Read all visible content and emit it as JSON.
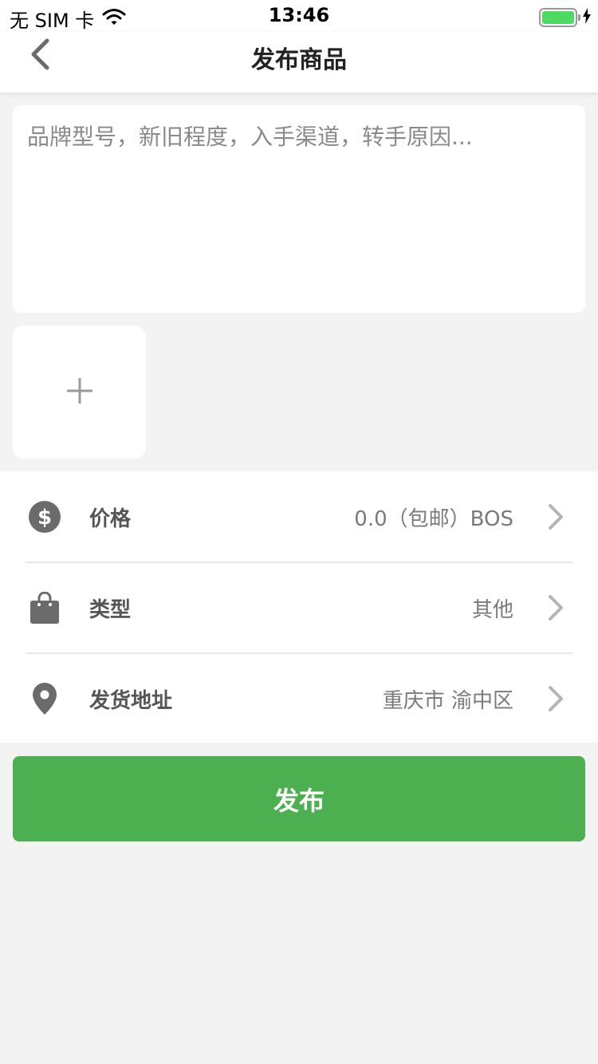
{
  "status_bar": {
    "carrier": "无 SIM 卡",
    "time": "13:46",
    "battery_icon": "battery-icon",
    "charging_icon": "bolt-icon",
    "wifi_icon": "wifi-icon"
  },
  "nav": {
    "title": "发布商品",
    "back_icon": "chevron-left-icon"
  },
  "description": {
    "placeholder": "品牌型号，新旧程度，入手渠道，转手原因...",
    "value": ""
  },
  "photo": {
    "add_icon": "plus-icon"
  },
  "settings": [
    {
      "icon": "dollar-circle-icon",
      "label": "价格",
      "value": "0.0（包邮）BOS"
    },
    {
      "icon": "shopping-bag-icon",
      "label": "类型",
      "value": "其他"
    },
    {
      "icon": "location-pin-icon",
      "label": "发货地址",
      "value": "重庆市 渝中区"
    }
  ],
  "publish_button": {
    "label": "发布"
  },
  "colors": {
    "accent": "#4caf50",
    "background": "#f3f3f3",
    "icon_gray": "#6b6b6b",
    "chevron_gray": "#b5b5b5",
    "battery_green": "#4cd964"
  }
}
